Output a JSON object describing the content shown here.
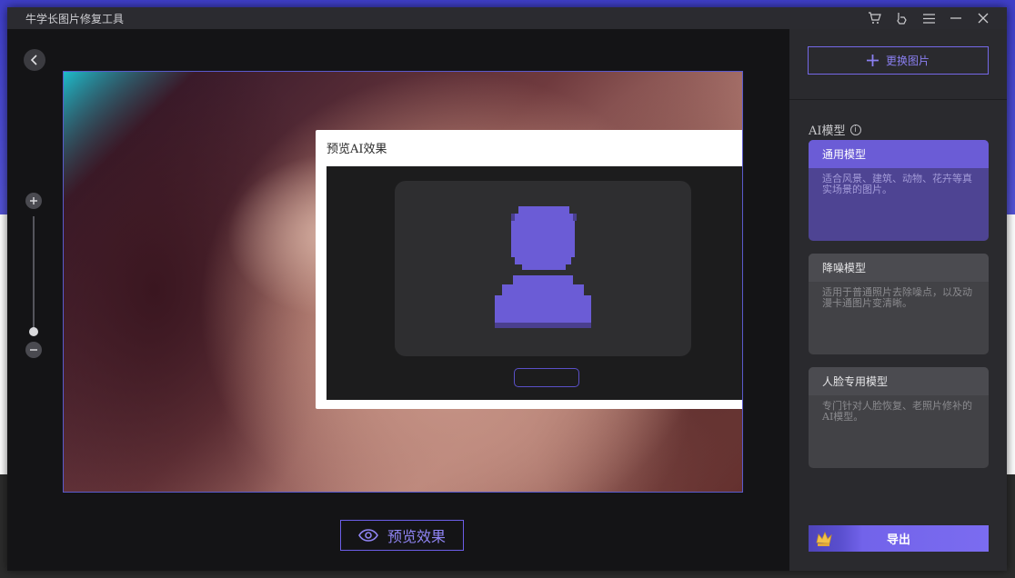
{
  "window": {
    "title": "牛学长图片修复工具",
    "titlebar_icons": [
      "cart-icon",
      "feedback-icon",
      "menu-icon",
      "minimize-icon",
      "close-icon"
    ]
  },
  "preview_dialog": {
    "title": "预览AI效果"
  },
  "toolbar": {
    "preview_label": "预览效果"
  },
  "sidebar": {
    "replace_label": "更换图片",
    "ai_model_label": "AI模型",
    "models": [
      {
        "title": "通用模型",
        "desc": "适合风景、建筑、动物、花卉等真实场景的图片。",
        "active": true
      },
      {
        "title": "降噪模型",
        "desc": "适用于普通照片去除噪点，以及动漫卡通图片变清晰。",
        "active": false
      },
      {
        "title": "人脸专用模型",
        "desc": "专门针对人脸恢复、老照片修补的AI模型。",
        "active": false
      }
    ],
    "export_label": "导出"
  },
  "colors": {
    "accent": "#6b5cd6",
    "accent_light": "#8a7ff0",
    "window_bg": "#121215",
    "sidebar_bg": "#2a2a2e"
  }
}
